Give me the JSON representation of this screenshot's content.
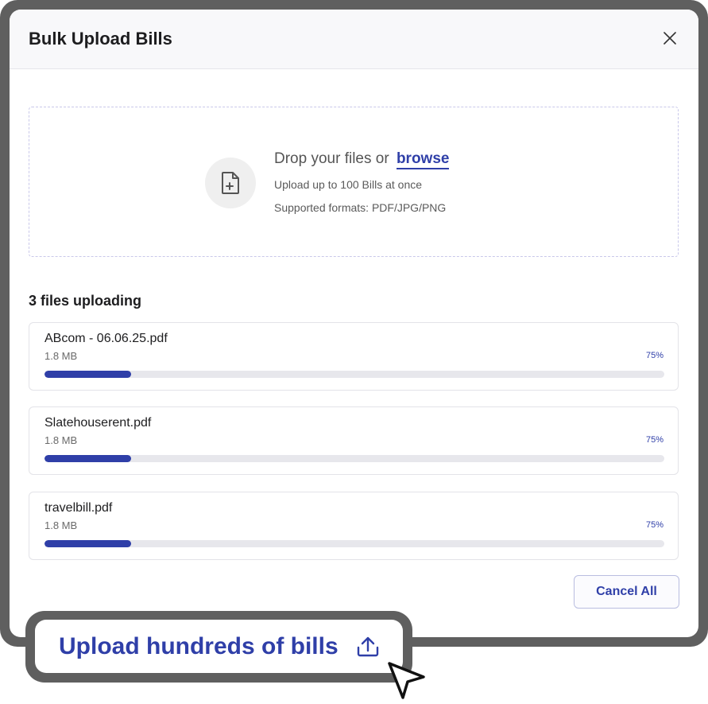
{
  "modal": {
    "title": "Bulk Upload Bills"
  },
  "dropzone": {
    "prompt": "Drop your files or",
    "browse_label": "browse",
    "limit_text": "Upload up to 100 Bills at once",
    "formats_text": "Supported formats: PDF/JPG/PNG"
  },
  "uploads": {
    "title": "3 files uploading",
    "files": [
      {
        "name": "ABcom - 06.06.25.pdf",
        "size": "1.8 MB",
        "percent_label": "75%",
        "progress": 0.14
      },
      {
        "name": "Slatehouserent.pdf",
        "size": "1.8 MB",
        "percent_label": "75%",
        "progress": 0.14
      },
      {
        "name": "travelbill.pdf",
        "size": "1.8 MB",
        "percent_label": "75%",
        "progress": 0.14
      }
    ]
  },
  "footer": {
    "cancel_all_label": "Cancel All"
  },
  "callout": {
    "label": "Upload hundreds of bills"
  },
  "icons": {
    "close": "close-icon",
    "file_add": "file-add-icon",
    "upload": "upload-icon",
    "cursor": "cursor-arrow-icon"
  },
  "colors": {
    "accent": "#2f3fa8",
    "frame": "#5f5f5f",
    "track": "#e7e7ec"
  }
}
